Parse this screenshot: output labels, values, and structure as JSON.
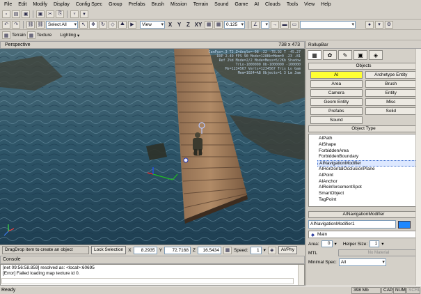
{
  "menu": [
    "File",
    "Edit",
    "Modify",
    "Display",
    "Config Spec",
    "Group",
    "Prefabs",
    "Brush",
    "Mission",
    "Terrain",
    "Sound",
    "Game",
    "AI",
    "Clouds",
    "Tools",
    "View",
    "Help"
  ],
  "toolbar": {
    "selection_filter": "Select All",
    "coord_system": "View",
    "axes": [
      "X",
      "Y",
      "Z",
      "XY"
    ],
    "snap_value": "0.125"
  },
  "toolbar3": {
    "terrain_label": "Terrain",
    "texture_label": "Texture",
    "lighting_label": "Lighting"
  },
  "viewport": {
    "title": "Perspective",
    "resolution": "738 x 473",
    "overlay_lines": [
      "CamPos=  3  T2  Z=Angle=-98  .22  -78.92  T  -45.27",
      "DXP 2.49 FPS 90 Mode=128Kb=Mem=0  .23  .81",
      "Ref 2%d  Mode=2/2 Mode=Mess=5/2Kb  Shadow",
      "TrLo-1000000  Ob-1000000 -100000",
      "Ms=1234567 Verts=1234567 Tris  Lo Gam",
      "Mem=1024=AB Objects=1 3 Lm Jam"
    ]
  },
  "bottom_bar": {
    "hint": "DragDrop item to create an object",
    "lock_selection": "Lock Selection",
    "x_label": "X",
    "x_value": "8.2935",
    "y_label": "Y",
    "y_value": "72.7168",
    "z_label": "Z",
    "z_value": "16.5434",
    "speed_label": "Speed:",
    "speed_value": "1",
    "ai_physics": "AI/Phy"
  },
  "console": {
    "title": "Console",
    "lines": [
      "[net 09:56:58.859] resolved as: <local>:60695",
      "[Error] Failed loading map texture id 0."
    ]
  },
  "status": {
    "left": "Ready",
    "memory": "398 Mb",
    "cap": "CAP",
    "num": "NUM",
    "scrl": "SCRL"
  },
  "rollup": {
    "title": "RollupBar",
    "objects_header": "Objects",
    "object_buttons": [
      {
        "label": "AI",
        "active": true
      },
      {
        "label": "Archetype Entity",
        "active": false
      },
      {
        "label": "Area",
        "active": false
      },
      {
        "label": "Brush",
        "active": false
      },
      {
        "label": "Camera",
        "active": false
      },
      {
        "label": "Entity",
        "active": false
      },
      {
        "label": "Geom Entity",
        "active": false
      },
      {
        "label": "Misc",
        "active": false
      },
      {
        "label": "Prefabs",
        "active": false
      },
      {
        "label": "Solid",
        "active": false
      },
      {
        "label": "Sound",
        "active": false
      }
    ],
    "object_type_header": "Object Type",
    "object_types": [
      "AIPath",
      "AIShape",
      "ForbiddenArea",
      "ForbiddenBoundary",
      "AINavigationModifier",
      "AIHorizontalOcclusionPlane",
      "AIPoint",
      "AIAnchor",
      "AIReinforcementSpot",
      "SmartObject",
      "TagPoint"
    ],
    "selected_type": "AINavigationModifier",
    "nav_header": "AINavigationModifier",
    "nav_name": "AINavigationModifier1",
    "nav_color": "#1e88ff",
    "layer": "Main",
    "area_label": "Area:",
    "area_value": "0",
    "helper_label": "Helper Size:",
    "helper_value": "1",
    "mtl_label": "MTL",
    "mtl_value": "No Material",
    "minspec_label": "Minimal Spec:",
    "minspec_value": "All"
  }
}
